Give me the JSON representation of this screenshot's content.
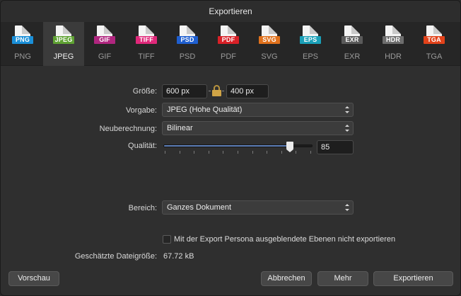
{
  "window": {
    "title": "Exportieren"
  },
  "formats": [
    {
      "tag": "PNG",
      "name": "PNG",
      "color": "#1a8fd8",
      "active": false
    },
    {
      "tag": "JPEG",
      "name": "JPEG",
      "color": "#5fa233",
      "active": true
    },
    {
      "tag": "GIF",
      "name": "GIF",
      "color": "#b0267f",
      "active": false
    },
    {
      "tag": "TIFF",
      "name": "TIFF",
      "color": "#e0287a",
      "active": false
    },
    {
      "tag": "PSD",
      "name": "PSD",
      "color": "#1f5fd0",
      "active": false
    },
    {
      "tag": "PDF",
      "name": "PDF",
      "color": "#d92027",
      "active": false
    },
    {
      "tag": "SVG",
      "name": "SVG",
      "color": "#e0711c",
      "active": false
    },
    {
      "tag": "EPS",
      "name": "EPS",
      "color": "#1aa0b8",
      "active": false
    },
    {
      "tag": "EXR",
      "name": "EXR",
      "color": "#5a5a5a",
      "active": false
    },
    {
      "tag": "HDR",
      "name": "HDR",
      "color": "#6d6d6d",
      "active": false
    },
    {
      "tag": "TGA",
      "name": "TGA",
      "color": "#e2421a",
      "active": false
    }
  ],
  "form": {
    "size_label": "Größe:",
    "width_value": "600 px",
    "height_value": "400 px",
    "preset_label": "Vorgabe:",
    "preset_value": "JPEG (Hohe Qualität)",
    "resample_label": "Neuberechnung:",
    "resample_value": "Bilinear",
    "quality_label": "Qualität:",
    "quality_value": "85",
    "quality_fraction": 0.85,
    "area_label": "Bereich:",
    "area_value": "Ganzes Dokument",
    "hidden_layers_label": "Mit der Export Persona ausgeblendete Ebenen nicht exportieren",
    "filesize_label": "Geschätzte Dateigröße:",
    "filesize_value": "67.72 kB"
  },
  "buttons": {
    "preview": "Vorschau",
    "cancel": "Abbrechen",
    "more": "Mehr",
    "export": "Exportieren"
  }
}
